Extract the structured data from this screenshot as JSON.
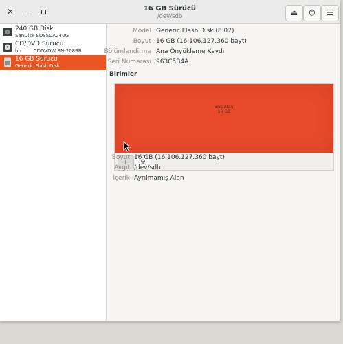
{
  "window": {
    "title": "16 GB Sürücü",
    "subtitle": "/dev/sdb",
    "close_glyph": "✕",
    "minimize_glyph": "_",
    "maximize_glyph": "▫",
    "eject_glyph": "⏏",
    "power_glyph": "⏻",
    "menu_glyph": "☰"
  },
  "drives": [
    {
      "name": "240 GB Disk",
      "sub": "SanDisk SDSSDA240G",
      "icon": "hard-disk-icon",
      "selected": false
    },
    {
      "name": "CD/DVD Sürücü",
      "sub": "hp        CDDVDW SN-208BB",
      "icon": "optical-drive-icon",
      "selected": false
    },
    {
      "name": "16 GB Sürücü",
      "sub": "Generic Flash Disk",
      "icon": "usb-drive-icon",
      "selected": true
    }
  ],
  "drive_info": {
    "model_label": "Model",
    "model_value": "Generic Flash Disk (8.07)",
    "size_label": "Boyut",
    "size_value": "16 GB (16.106.127.360 bayt)",
    "partitioning_label": "Bölümlendirme",
    "partitioning_value": "Ana Önyükleme Kaydı",
    "serial_label": "Seri Numarası",
    "serial_value": "963C5B4A"
  },
  "units": {
    "heading": "Birimler",
    "volume_label_1": "Boş Alan",
    "volume_label_2": "16 GB",
    "volume_color": "#e8492b",
    "add_glyph": "+",
    "settings_glyph": "⚙"
  },
  "volume_info": {
    "size_label": "Boyut",
    "size_value": "16 GB (16.106.127.360 bayt)",
    "device_label": "Aygıt",
    "device_value": "/dev/sdb",
    "contents_label": "İçerik",
    "contents_value": "Ayrılmamış Alan"
  },
  "colors": {
    "accent": "#e95420",
    "sidebar_bg": "#ffffff",
    "window_bg": "#f6f5f4"
  }
}
